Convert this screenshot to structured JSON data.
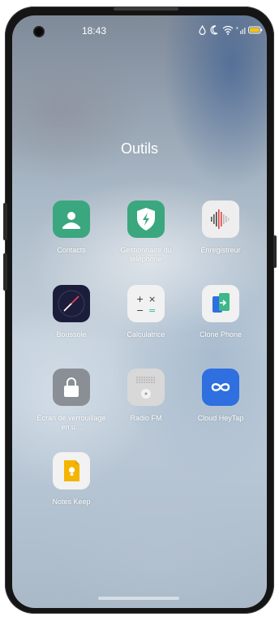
{
  "status_bar": {
    "time": "18:43",
    "icons": [
      "drop-icon",
      "moon-icon",
      "wifi-icon",
      "signal-icon",
      "battery-icon"
    ],
    "battery_color": "#f4c21b"
  },
  "folder": {
    "title": "Outils"
  },
  "apps": [
    {
      "label": "Contacts",
      "icon": "contacts-icon",
      "color": "#3aa77e"
    },
    {
      "label": "Gestionnaire du téléphone",
      "icon": "phone-manager-icon",
      "color": "#3aa77e"
    },
    {
      "label": "Enregistreur",
      "icon": "recorder-icon",
      "color": "#eeeeee"
    },
    {
      "label": "Boussole",
      "icon": "compass-icon",
      "color": "#1c1d3a"
    },
    {
      "label": "Calculatrice",
      "icon": "calculator-icon",
      "color": "#f1f1f1"
    },
    {
      "label": "Clone Phone",
      "icon": "clone-phone-icon",
      "color": "#f1f1f1"
    },
    {
      "label": "Écran de verrouillage en u...",
      "icon": "lock-screen-icon",
      "color": "#8a8f96"
    },
    {
      "label": "Radio FM",
      "icon": "radio-fm-icon",
      "color": "#d8d8d8"
    },
    {
      "label": "Cloud HeyTap",
      "icon": "cloud-heytap-icon",
      "color": "#2f6fe0"
    },
    {
      "label": "Notes Keep",
      "icon": "notes-keep-icon",
      "color": "#f2f2f2"
    }
  ]
}
